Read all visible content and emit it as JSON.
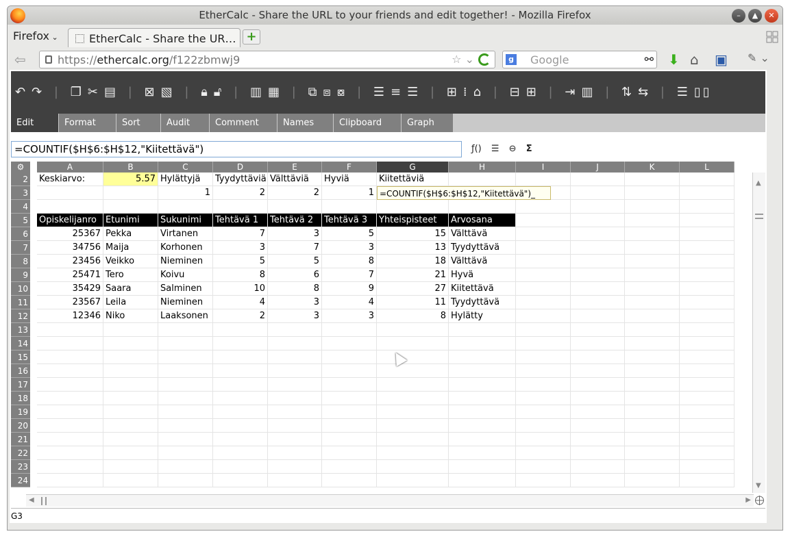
{
  "window": {
    "title": "EtherCalc - Share the URL to your friends and edit together! - Mozilla Firefox",
    "min_icon": "minimize-icon",
    "max_icon": "maximize-icon",
    "close_icon": "close-icon"
  },
  "browser": {
    "menu_label": "Firefox",
    "tab_label": "EtherCalc - Share the UR…",
    "url_prefix": "https://",
    "url_host": "ethercalc.org",
    "url_path": "/f122zbmwj9",
    "search_placeholder": "Google",
    "search_engine_badge": "g"
  },
  "toolbar": {
    "icons": [
      "undo-icon",
      "redo-icon",
      "copy-icon",
      "cut-icon",
      "paste-icon",
      "delete-icon",
      "paste-format-icon",
      "lock-icon",
      "unlock-icon",
      "insert-column-icon",
      "insert-row-icon",
      "delete-column-icon",
      "delete-row-icon",
      "hide-icon",
      "align-left-icon",
      "align-center-icon",
      "align-right-icon",
      "borders-icon",
      "no-borders-icon",
      "clear-format-icon",
      "merge-icon",
      "unmerge-icon",
      "sum-icon",
      "move-icon",
      "paste-move-icon",
      "swap-row-icon",
      "swap-col-icon",
      "insert-rows-icon",
      "insert-cols-icon"
    ]
  },
  "menu": {
    "tabs": [
      "Edit",
      "Format",
      "Sort",
      "Audit",
      "Comment",
      "Names",
      "Clipboard",
      "Graph"
    ],
    "active": "Edit"
  },
  "formula_bar": {
    "value": "=COUNTIF($H$6:$H$12,\"Kiitettävä\")",
    "icons": [
      "function-icon",
      "multiline-icon",
      "link-icon",
      "sum-icon"
    ],
    "fx_label": "ƒ()",
    "sigma": "Σ"
  },
  "grid": {
    "columns": [
      "A",
      "B",
      "C",
      "D",
      "E",
      "F",
      "G",
      "H",
      "I",
      "J",
      "K",
      "L"
    ],
    "selected_column": "G",
    "row_numbers": [
      "2",
      "3",
      "4",
      "5",
      "6",
      "7",
      "8",
      "9",
      "10",
      "11",
      "12",
      "13",
      "14",
      "15",
      "16",
      "17",
      "18",
      "19",
      "20",
      "21",
      "22",
      "23",
      "24"
    ],
    "row2": [
      "Keskiarvo:",
      "5.57",
      "Hylättyjä",
      "Tyydyttäviä",
      "Välttäviä",
      "Hyviä",
      "Kiitettäviä",
      "",
      "",
      "",
      "",
      ""
    ],
    "row3": [
      "",
      "",
      "1",
      "2",
      "2",
      "1",
      "=COUNTIF($H$6:$H$12,\"Kiitettävä\")_",
      "",
      "",
      "",
      "",
      ""
    ],
    "header_row": [
      "Opiskelijanro",
      "Etunimi",
      "Sukunimi",
      "Tehtävä 1",
      "Tehtävä 2",
      "Tehtävä 3",
      "Yhteispisteet",
      "Arvosana"
    ],
    "data_rows": [
      [
        "25367",
        "Pekka",
        "Virtanen",
        "7",
        "3",
        "5",
        "15",
        "Välttävä"
      ],
      [
        "34756",
        "Maija",
        "Korhonen",
        "3",
        "7",
        "3",
        "13",
        "Tyydyttävä"
      ],
      [
        "23456",
        "Veikko",
        "Nieminen",
        "5",
        "5",
        "8",
        "18",
        "Välttävä"
      ],
      [
        "25471",
        "Tero",
        "Koivu",
        "8",
        "6",
        "7",
        "21",
        "Hyvä"
      ],
      [
        "35429",
        "Saara",
        "Salminen",
        "10",
        "8",
        "9",
        "27",
        "Kiitettävä"
      ],
      [
        "23567",
        "Leila",
        "Nieminen",
        "4",
        "3",
        "4",
        "11",
        "Tyydyttävä"
      ],
      [
        "12346",
        "Niko",
        "Laaksonen",
        "2",
        "3",
        "3",
        "8",
        "Hylätty"
      ]
    ]
  },
  "status": {
    "cell_ref": "G3"
  },
  "colors": {
    "toolbar_bg": "#404040",
    "tab_bg": "#808080",
    "highlight": "#ffff99"
  }
}
